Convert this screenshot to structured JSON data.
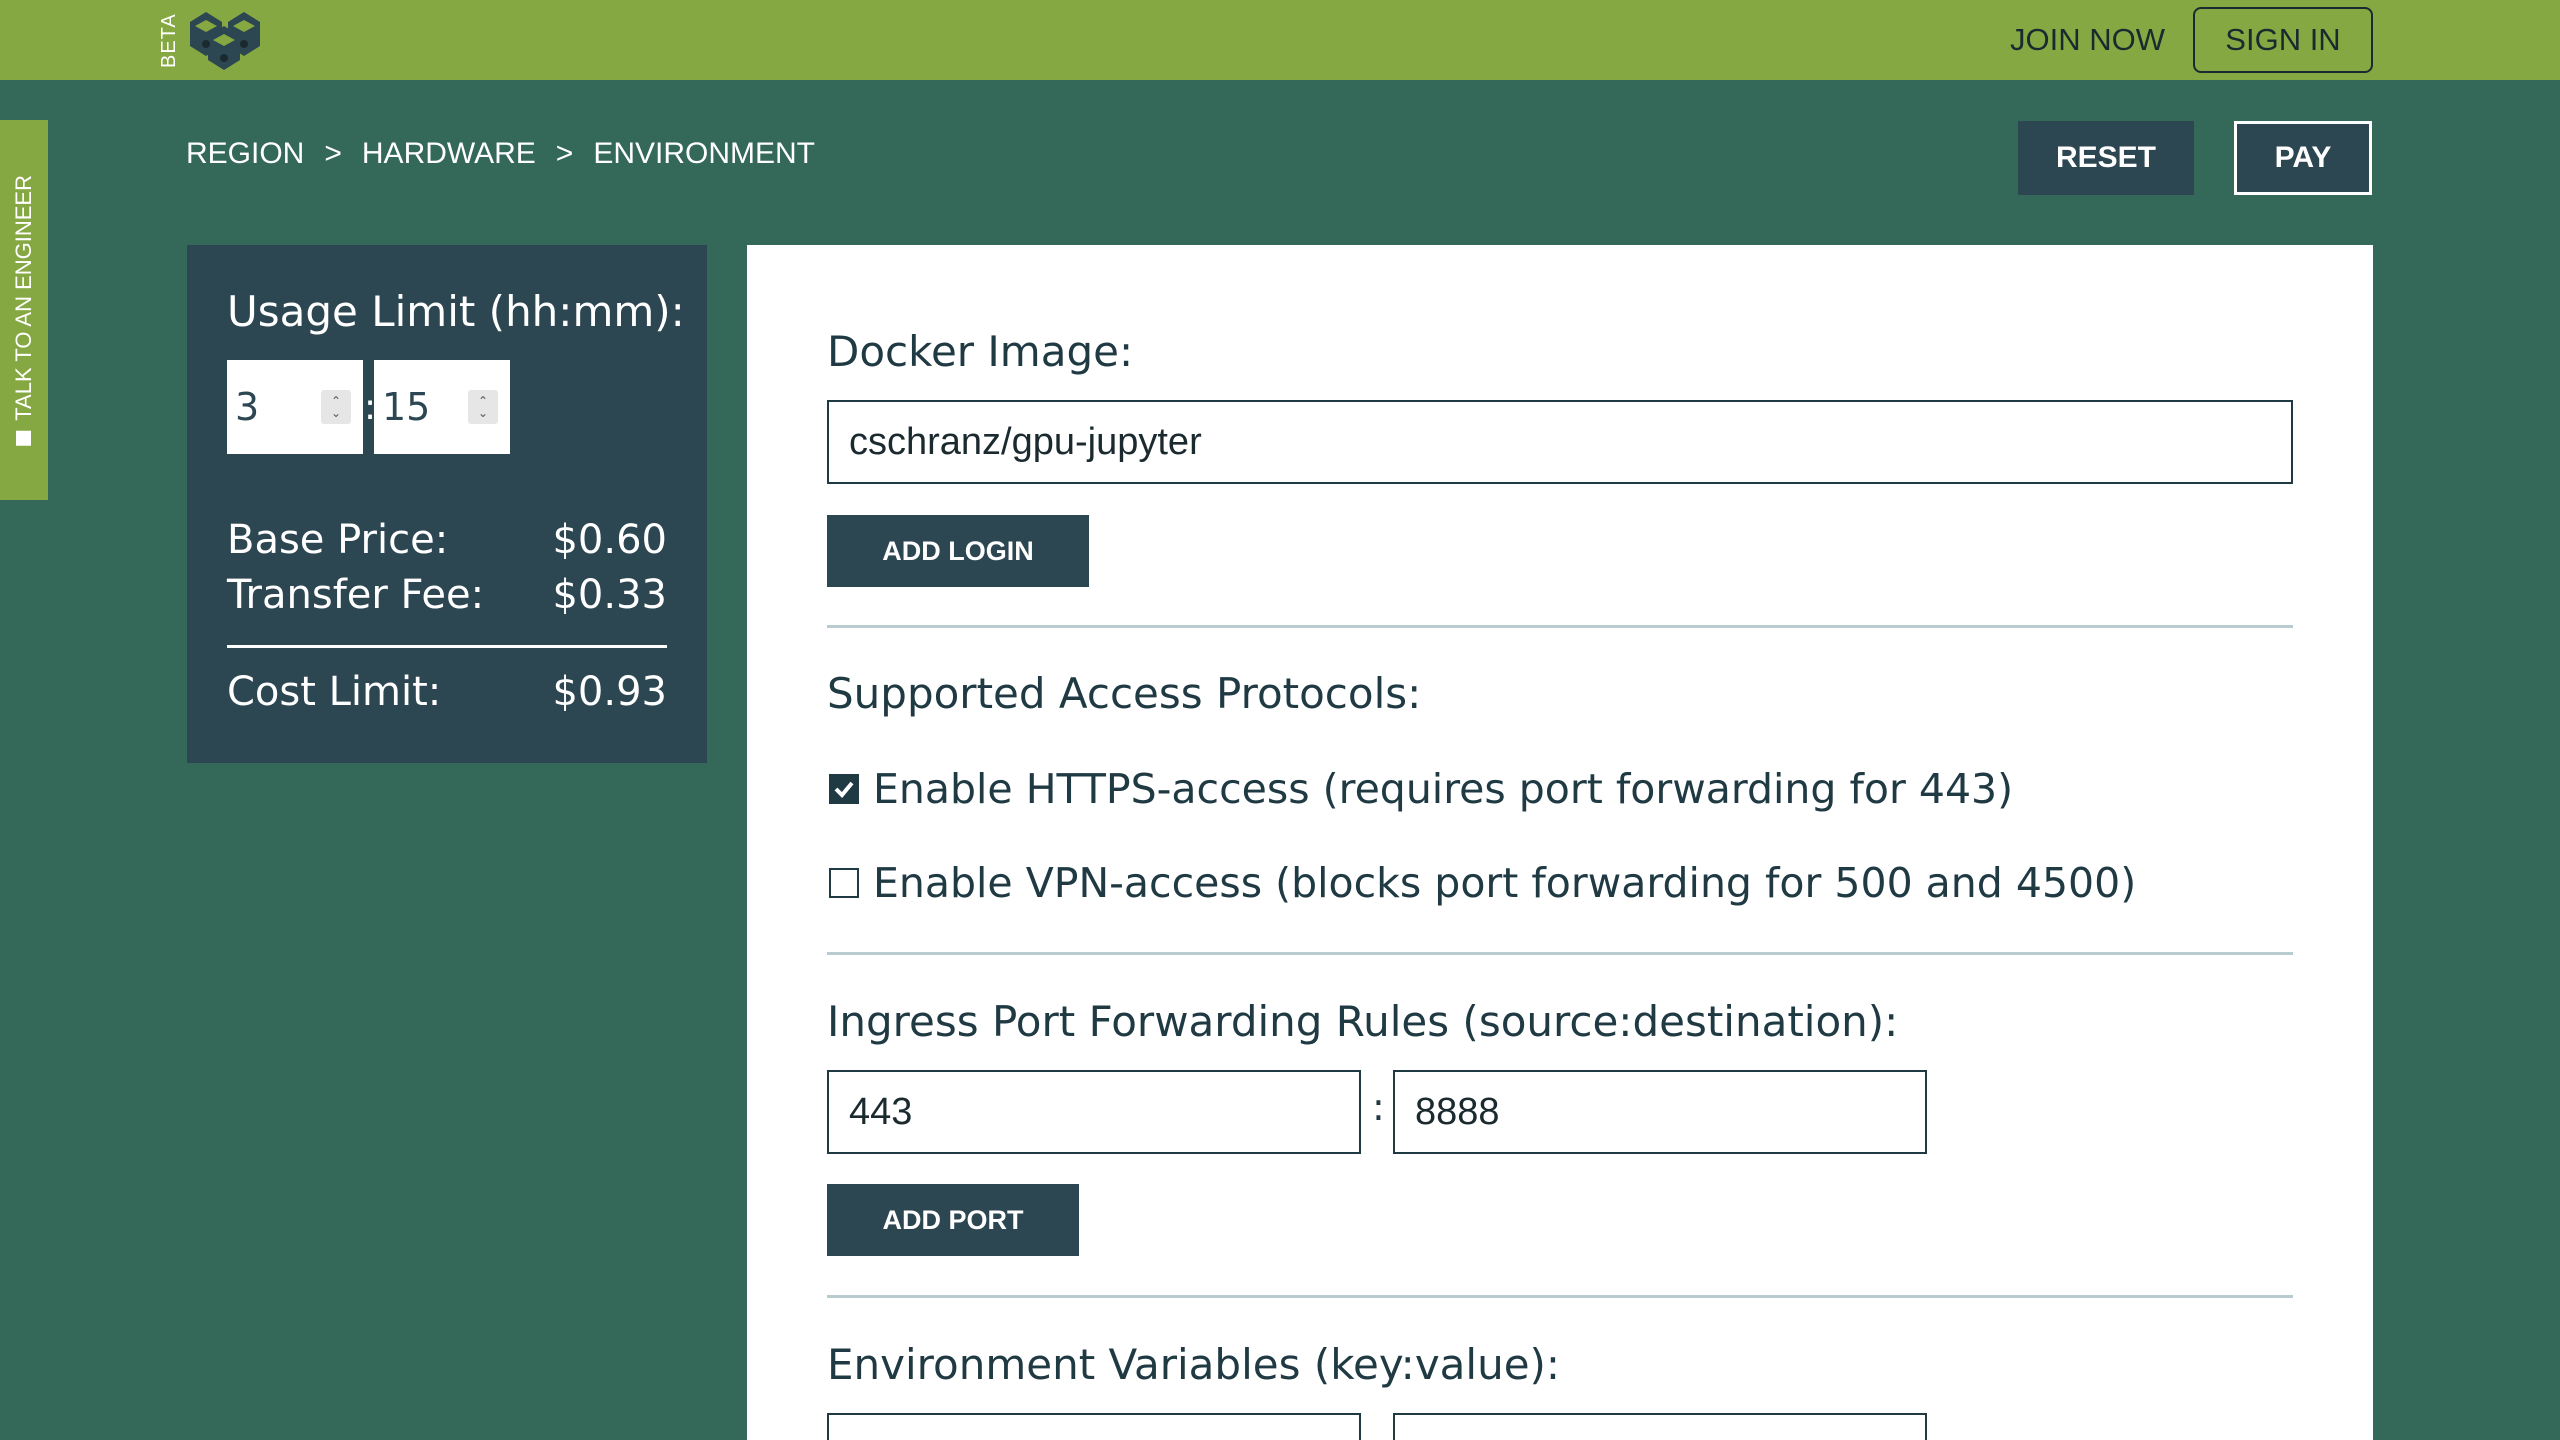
{
  "header": {
    "beta_label": "BETA",
    "join_now_label": "JOIN NOW",
    "sign_in_label": "SIGN IN"
  },
  "side_tab": {
    "label": "TALK TO AN ENGINEER"
  },
  "breadcrumb": {
    "items": [
      "REGION",
      "HARDWARE",
      "ENVIRONMENT"
    ],
    "separator": ">"
  },
  "actions": {
    "reset_label": "RESET",
    "pay_label": "PAY"
  },
  "summary": {
    "usage_label": "Usage Limit (hh:mm):",
    "hours": "3",
    "minutes": "15",
    "time_separator": ":",
    "base_price_label": "Base Price:",
    "base_price_value": "$0.60",
    "transfer_fee_label": "Transfer Fee:",
    "transfer_fee_value": "$0.33",
    "cost_limit_label": "Cost Limit:",
    "cost_limit_value": "$0.93"
  },
  "main": {
    "docker_heading": "Docker Image:",
    "docker_value": "cschranz/gpu-jupyter",
    "add_login_label": "ADD LOGIN",
    "protocols_heading": "Supported Access Protocols:",
    "https_label": "Enable HTTPS-access (requires port forwarding for 443)",
    "https_checked": true,
    "vpn_label": "Enable VPN-access (blocks port forwarding for 500 and 4500)",
    "vpn_checked": false,
    "ingress_heading": "Ingress Port Forwarding Rules (source:destination):",
    "port_source": "443",
    "port_destination": "8888",
    "port_separator": ":",
    "add_port_label": "ADD PORT",
    "env_heading": "Environment Variables (key:value):"
  },
  "colors": {
    "background": "#346859",
    "header": "#86a843",
    "panel_dark": "#2c4652",
    "text_dark": "#203a44"
  }
}
